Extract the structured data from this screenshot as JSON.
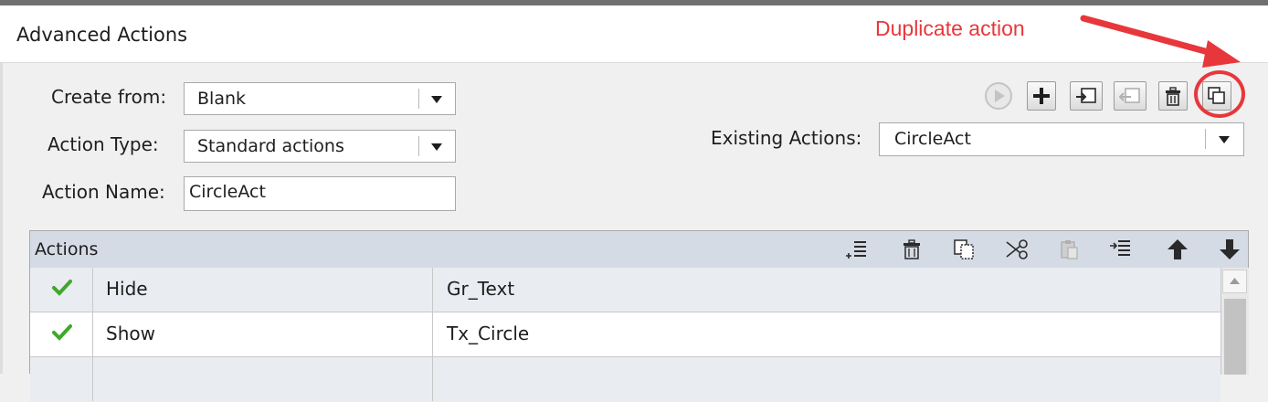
{
  "window": {
    "title": "Advanced Actions"
  },
  "annotation": {
    "text": "Duplicate action",
    "color": "#e8373b"
  },
  "form": {
    "create_from": {
      "label": "Create from:",
      "value": "Blank"
    },
    "action_type": {
      "label": "Action Type:",
      "value": "Standard actions"
    },
    "action_name": {
      "label": "Action Name:",
      "value": "CircleAct"
    },
    "existing_actions": {
      "label": "Existing Actions:",
      "value": "CircleAct"
    }
  },
  "toolbar": {
    "icons": [
      "play-icon",
      "add-icon",
      "import-icon",
      "export-icon",
      "trash-icon",
      "duplicate-icon"
    ]
  },
  "actions_grid": {
    "header": "Actions",
    "header_icons": [
      "insert-row-icon",
      "trash-icon",
      "copy-icon",
      "cut-icon",
      "paste-icon",
      "indent-icon",
      "move-up-icon",
      "move-down-icon"
    ],
    "rows": [
      {
        "checked": true,
        "action": "Hide",
        "target": "Gr_Text"
      },
      {
        "checked": true,
        "action": "Show",
        "target": "Tx_Circle"
      },
      {
        "checked": false,
        "action": "",
        "target": ""
      }
    ]
  }
}
